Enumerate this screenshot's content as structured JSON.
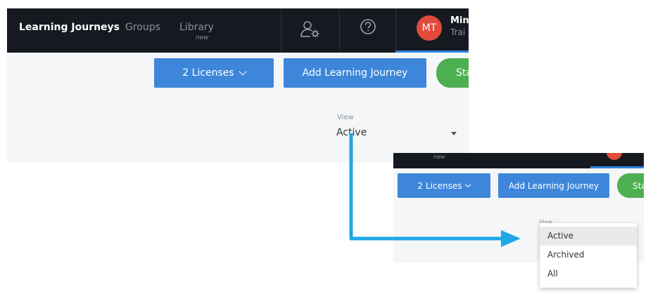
{
  "nav": {
    "brand": "Learning Journeys",
    "groups": "Groups",
    "library": "Library",
    "library_badge": "new",
    "user_settings_icon": "user-settings-icon",
    "help_icon": "help-icon"
  },
  "user": {
    "initials": "MT",
    "name": "Min",
    "role": "Trai"
  },
  "toolbar": {
    "licenses_label": "2 Licenses",
    "add_journey_label": "Add Learning Journey",
    "start_label": "Sta"
  },
  "view_filter": {
    "label": "View",
    "value": "Active",
    "options": [
      "Active",
      "Archived",
      "All"
    ]
  },
  "zoom": {
    "badge": "new",
    "view_label": "View"
  },
  "colors": {
    "topbar": "#161a20",
    "primary_button": "#3d86da",
    "start_button": "#4caf50",
    "avatar": "#e24a3b",
    "active_tab": "#2f86e0",
    "arrow": "#1ea7e6"
  }
}
